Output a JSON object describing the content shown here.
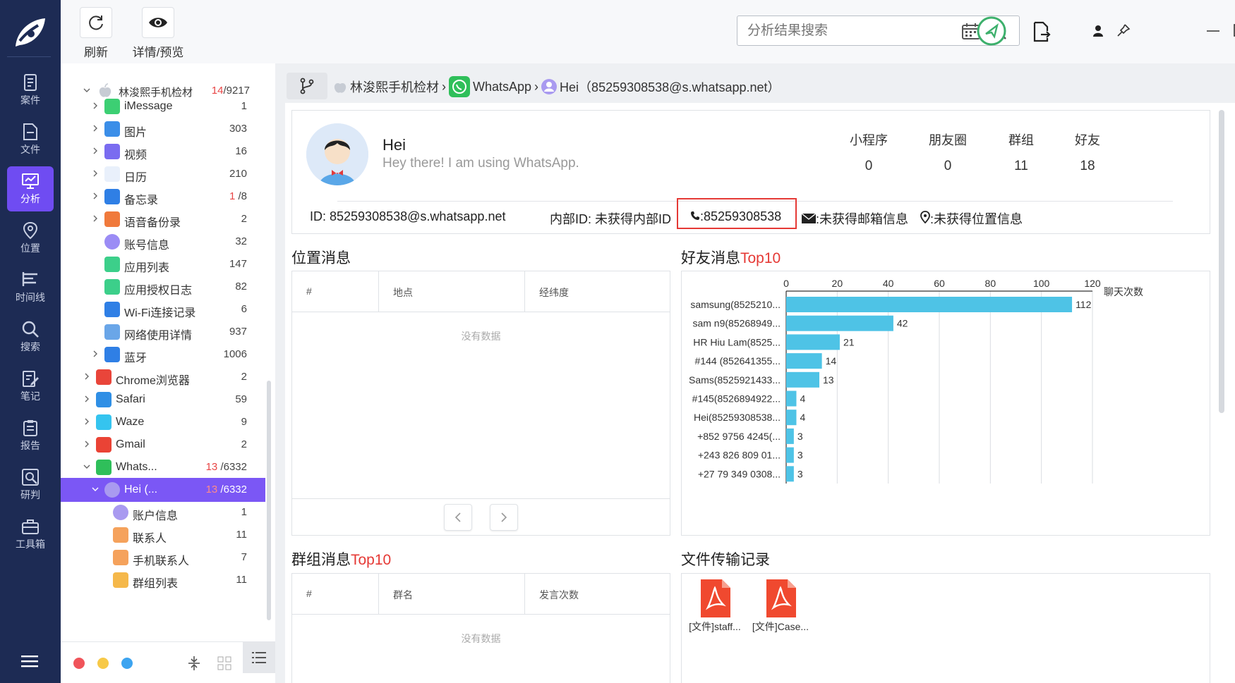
{
  "nav": {
    "items": [
      {
        "label": "案件",
        "icon": "document-icon"
      },
      {
        "label": "文件",
        "icon": "file-icon"
      },
      {
        "label": "分析",
        "icon": "monitor-analysis-icon"
      },
      {
        "label": "位置",
        "icon": "location-pin-icon"
      },
      {
        "label": "时间线",
        "icon": "timeline-icon"
      },
      {
        "label": "搜索",
        "icon": "search-icon"
      },
      {
        "label": "笔记",
        "icon": "notes-icon"
      },
      {
        "label": "报告",
        "icon": "report-icon"
      },
      {
        "label": "研判",
        "icon": "judgment-icon"
      },
      {
        "label": "工具箱",
        "icon": "toolbox-icon"
      }
    ],
    "active_index": 2,
    "active_color": "#6f4cf2"
  },
  "toolbar": {
    "refresh_label": "刷新",
    "preview_label": "详情/预览",
    "search_placeholder": "分析结果搜索"
  },
  "tree": {
    "root": {
      "label": "林浚熙手机检材",
      "count_red": "14",
      "count_total": "/9217"
    },
    "rows": [
      {
        "label": "iMessage",
        "count": "1"
      },
      {
        "label": "图片",
        "count": "303"
      },
      {
        "label": "视频",
        "count": "16"
      },
      {
        "label": "日历",
        "count": "210"
      },
      {
        "label": "备忘录",
        "count_red": "1",
        "count_total": "/8"
      },
      {
        "label": "语音备份录",
        "count": "2"
      },
      {
        "label": "账号信息",
        "count": "32"
      },
      {
        "label": "应用列表",
        "count": "147"
      },
      {
        "label": "应用授权日志",
        "count": "82"
      },
      {
        "label": "Wi-Fi连接记录",
        "count": "6"
      },
      {
        "label": "网络使用详情",
        "count": "937"
      },
      {
        "label": "蓝牙",
        "count": "1006"
      },
      {
        "label": "Chrome浏览器",
        "count": "2"
      },
      {
        "label": "Safari",
        "count": "59"
      },
      {
        "label": "Waze",
        "count": "9"
      },
      {
        "label": "Gmail",
        "count": "2"
      },
      {
        "label": "Whats...",
        "count_red": "13",
        "count_total": "/6332"
      },
      {
        "label": "Hei (...",
        "count_red": "13",
        "count_total": "/6332"
      },
      {
        "label": "账户信息",
        "count": "1"
      },
      {
        "label": "联系人",
        "count": "11"
      },
      {
        "label": "手机联系人",
        "count": "7"
      },
      {
        "label": "群组列表",
        "count": "11"
      }
    ]
  },
  "breadcrumb": {
    "items": [
      "林浚熙手机检材",
      "WhatsApp",
      "Hei（85259308538@s.whatsapp.net）"
    ],
    "sep": "›"
  },
  "profile": {
    "name": "Hei",
    "status": "Hey there! I am using WhatsApp.",
    "stats": [
      {
        "label": "小程序",
        "value": "0"
      },
      {
        "label": "朋友圈",
        "value": "0"
      },
      {
        "label": "群组",
        "value": "11"
      },
      {
        "label": "好友",
        "value": "18"
      }
    ],
    "id_text": "ID: 85259308538@s.whatsapp.net",
    "internal_id_text": "内部ID: 未获得内部ID",
    "phone_text": ":85259308538",
    "email_text": ":未获得邮箱信息",
    "location_text": ":未获得位置信息"
  },
  "location_section": {
    "title": "位置消息",
    "columns": [
      "#",
      "地点",
      "经纬度"
    ],
    "empty_text": "没有数据"
  },
  "group_section": {
    "title_main": "群组消息",
    "title_red": "Top10",
    "columns": [
      "#",
      "群名",
      "发言次数"
    ],
    "empty_text": "没有数据"
  },
  "friend_section": {
    "title_main": "好友消息",
    "title_red": "Top10"
  },
  "files_section": {
    "title": "文件传输记录",
    "files": [
      {
        "label": "[文件]staff...",
        "icon": "pdf-icon"
      },
      {
        "label": "[文件]Case...",
        "icon": "pdf-icon"
      }
    ]
  },
  "chart_data": {
    "type": "bar",
    "orientation": "horizontal",
    "categories": [
      "samsung(8525210...",
      "sam n9(85268949...",
      "HR Hiu Lam(8525...",
      "#144 (852641355...",
      "Sams(8525921433...",
      "#145(8526894922...",
      "Hei(85259308538...",
      "+852 9756 4245(...",
      "+243 826 809 01...",
      "+27 79 349 0308..."
    ],
    "values": [
      112,
      42,
      21,
      14,
      13,
      4,
      4,
      3,
      3,
      3
    ],
    "xlabel": "聊天次数",
    "xlim": [
      0,
      120
    ],
    "ticks": [
      "0",
      "20",
      "40",
      "60",
      "80",
      "100",
      "120"
    ],
    "bar_color": "#4ec3e6",
    "grid": true
  }
}
